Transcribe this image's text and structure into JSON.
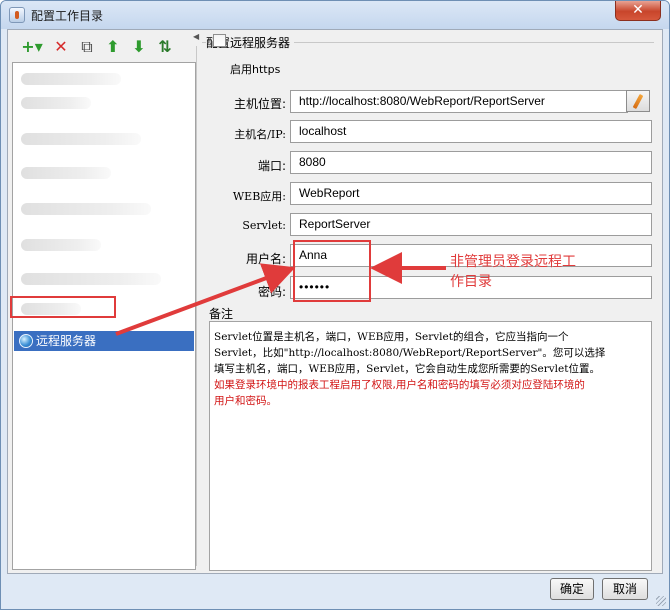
{
  "window": {
    "title": "配置工作目录",
    "close_label": "✕"
  },
  "toolbar": {
    "add": "+▾",
    "delete": "✕",
    "copy": "⧉",
    "up": "⬆",
    "down": "⬇",
    "sort": "⇅"
  },
  "tree": {
    "selected_item": "远程服务器"
  },
  "config": {
    "group_title": "配置远程服务器",
    "https_label": "启用https",
    "https_checked": false,
    "host_label": "主机位置:",
    "host_value": "http://localhost:8080/WebReport/ReportServer",
    "hostname_label": "主机名/IP:",
    "hostname_value": "localhost",
    "port_label": "端口:",
    "port_value": "8080",
    "webapp_label": "WEB应用:",
    "webapp_value": "WebReport",
    "servlet_label": "Servlet:",
    "servlet_value": "ReportServer",
    "username_label": "用户名:",
    "username_value": "Anna",
    "password_label": "密码:",
    "password_value": "••••••"
  },
  "annotation": {
    "text": "非管理员登录远程工作目录"
  },
  "remark": {
    "label": "备注",
    "line1": "Servlet位置是主机名，端口，WEB应用，Servlet的组合，它应当指向一个",
    "line2": "Servlet，比如\"http://localhost:8080/WebReport/ReportServer\"。您可以选择",
    "line3": "填写主机名，端口，WEB应用，Servlet，它会自动生成您所需要的Servlet位置。",
    "red1": "如果登录环境中的报表工程启用了权限,用户名和密码的填写必须对应登陆环境的",
    "red2": "用户和密码。"
  },
  "buttons": {
    "ok": "确定",
    "cancel": "取消"
  },
  "colors": {
    "selection": "#3a6fc1",
    "annotation_red": "#e03b3b",
    "remark_red": "#d21414"
  }
}
